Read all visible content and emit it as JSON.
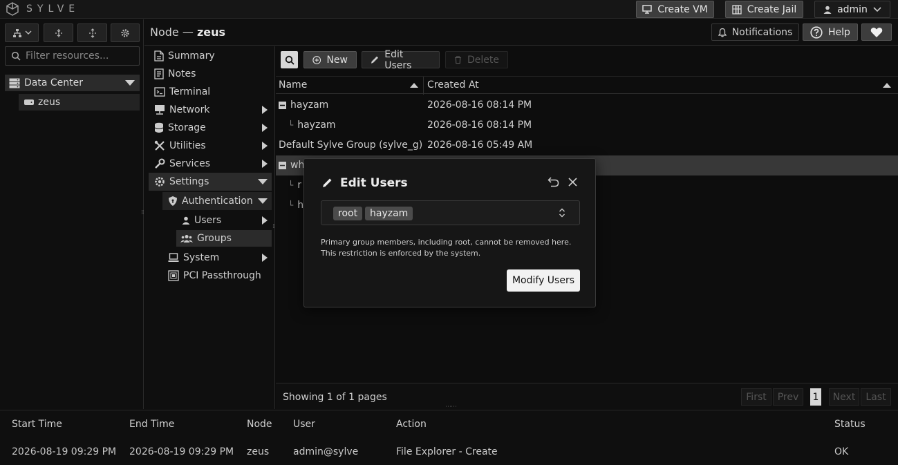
{
  "app": {
    "brand": "SYLVE"
  },
  "topbar": {
    "create_vm": "Create VM",
    "create_jail": "Create Jail",
    "user": "admin"
  },
  "sidebar": {
    "filter_placeholder": "Filter resources...",
    "tree": {
      "datacenter": "Data Center",
      "node": "zeus"
    }
  },
  "header": {
    "title_prefix": "Node —",
    "title_node": "zeus",
    "notifications": "Notifications",
    "help": "Help"
  },
  "menu": {
    "summary": "Summary",
    "notes": "Notes",
    "terminal": "Terminal",
    "network": "Network",
    "storage": "Storage",
    "utilities": "Utilities",
    "services": "Services",
    "settings": "Settings",
    "authentication": "Authentication",
    "users": "Users",
    "groups": "Groups",
    "system": "System",
    "pci": "PCI Passthrough"
  },
  "toolbar": {
    "new": "New",
    "edit_users": "Edit Users",
    "delete": "Delete"
  },
  "table": {
    "columns": [
      "Name",
      "Created At"
    ],
    "rows": [
      {
        "name": "hayzam",
        "created": "2026-08-16 08:14 PM"
      },
      {
        "name": "hayzam",
        "created": "2026-08-16 08:14 PM"
      },
      {
        "name": "Default Sylve Group (sylve_g)",
        "created": "2026-08-16 05:49 AM"
      },
      {
        "name": "wh",
        "created": ""
      },
      {
        "name": "r",
        "created": ""
      },
      {
        "name": "h",
        "created": ""
      }
    ],
    "pagination": {
      "summary": "Showing 1 of 1 pages",
      "first": "First",
      "prev": "Prev",
      "page": "1",
      "next": "Next",
      "last": "Last"
    }
  },
  "modal": {
    "title": "Edit Users",
    "selected": [
      "root",
      "hayzam"
    ],
    "note": "Primary group members, including root, cannot be removed here. This restriction is enforced by the system.",
    "submit": "Modify Users"
  },
  "tasklog": {
    "columns": [
      "Start Time",
      "End Time",
      "Node",
      "User",
      "Action",
      "Status"
    ],
    "row": {
      "start": "2026-08-19 09:29 PM",
      "end": "2026-08-19 09:29 PM",
      "node": "zeus",
      "user": "admin@sylve",
      "action": "File Explorer - Create",
      "status": "OK"
    }
  }
}
